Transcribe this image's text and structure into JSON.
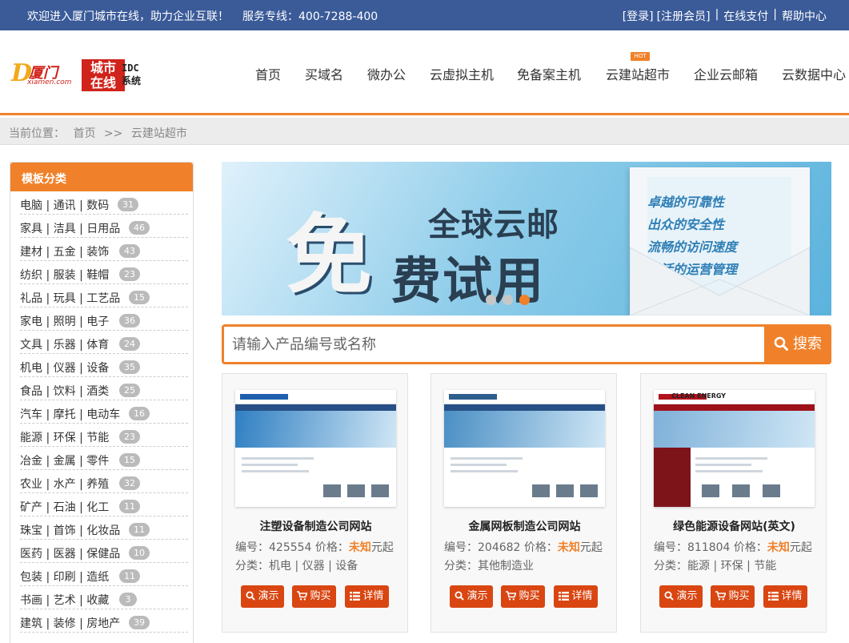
{
  "topbar": {
    "welcome": "欢迎进入厦门城市在线，助力企业互联！",
    "hotline": "服务专线：400-7288-400",
    "links": [
      "[登录]",
      "[注册会员]",
      "在线支付",
      "帮助中心"
    ]
  },
  "logo": {
    "brand_latin": "D",
    "brand_cn": "厦门",
    "brand_sub": "xiamen.com",
    "badge_line1": "城市",
    "badge_line2": "在线",
    "idc": "IDC",
    "idc_sub": "系统"
  },
  "nav": {
    "items": [
      "首页",
      "买域名",
      "微办公",
      "云虚拟主机",
      "免备案主机",
      "云建站超市",
      "企业云邮箱",
      "云数据中心"
    ],
    "hot_label": "HOT"
  },
  "breadcrumb": {
    "prefix": "当前位置：",
    "home": "首页",
    "sep": ">>",
    "current": "云建站超市"
  },
  "sidebar": {
    "title": "模板分类",
    "categories": [
      {
        "label": "电脑 | 通讯 | 数码",
        "count": "31"
      },
      {
        "label": "家具 | 洁具 | 日用品",
        "count": "46"
      },
      {
        "label": "建材 | 五金 | 装饰",
        "count": "43"
      },
      {
        "label": "纺织 | 服装 | 鞋帽",
        "count": "23"
      },
      {
        "label": "礼品 | 玩具 | 工艺品",
        "count": "15"
      },
      {
        "label": "家电 | 照明 | 电子",
        "count": "36"
      },
      {
        "label": "文具 | 乐器 | 体育",
        "count": "24"
      },
      {
        "label": "机电 | 仪器 | 设备",
        "count": "35"
      },
      {
        "label": "食品 | 饮料 | 酒类",
        "count": "25"
      },
      {
        "label": "汽车 | 摩托 | 电动车",
        "count": "16"
      },
      {
        "label": "能源 | 环保 | 节能",
        "count": "23"
      },
      {
        "label": "冶金 | 金属 | 零件",
        "count": "15"
      },
      {
        "label": "农业 | 水产 | 养殖",
        "count": "32"
      },
      {
        "label": "矿产 | 石油 | 化工",
        "count": "11"
      },
      {
        "label": "珠宝 | 首饰 | 化妆品",
        "count": "11"
      },
      {
        "label": "医药 | 医器 | 保健品",
        "count": "10"
      },
      {
        "label": "包装 | 印刷 | 造纸",
        "count": "11"
      },
      {
        "label": "书画 | 艺术 | 收藏",
        "count": "3"
      },
      {
        "label": "建筑 | 装修 | 房地产",
        "count": "39"
      }
    ]
  },
  "banner": {
    "big": "免",
    "line1": "全球云邮",
    "line2": "费试用",
    "features": [
      "卓越的可靠性",
      "出众的安全性",
      "流畅的访问速度",
      "灵活的运营管理"
    ],
    "active_slide": 3
  },
  "search": {
    "placeholder": "请输入产品编号或名称",
    "button": "搜索"
  },
  "products": [
    {
      "name": "注塑设备制造公司网站",
      "code_label": "编号：",
      "code": "425554",
      "price_label": "价格：",
      "price": "未知",
      "price_suffix": "元起",
      "category_label": "分类：",
      "category": "机电 | 仪器 | 设备",
      "thumb_logo": "#1f5fae",
      "thumb_hero": "#2f7fc2"
    },
    {
      "name": "金属网板制造公司网站",
      "code_label": "编号：",
      "code": "204682",
      "price_label": "价格：",
      "price": "未知",
      "price_suffix": "元起",
      "category_label": "分类：",
      "category": "其他制造业",
      "thumb_logo": "#2d5e8e",
      "thumb_hero": "#4a8fc4"
    },
    {
      "name": "绿色能源设备网站(英文)",
      "code_label": "编号：",
      "code": "811804",
      "price_label": "价格：",
      "price": "未知",
      "price_suffix": "元起",
      "category_label": "分类：",
      "category": "能源 | 环保 | 节能",
      "thumb_logo": "#b3121c",
      "thumb_hero": "#7fb1d9",
      "thumb_brand": "CLEAN ENERGY"
    }
  ],
  "card_buttons": {
    "demo": "演示",
    "buy": "购买",
    "detail": "详情"
  },
  "colors": {
    "topbar": "#3a5a98",
    "accent": "#f0812a",
    "button": "#d94612"
  }
}
